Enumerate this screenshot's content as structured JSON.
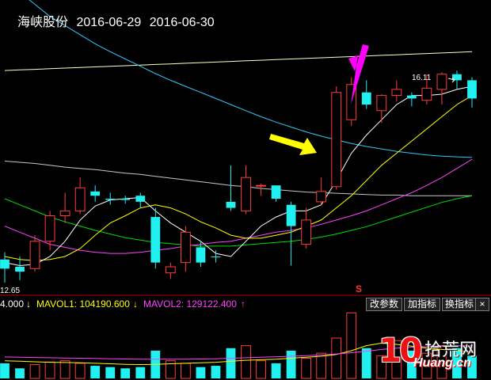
{
  "header": {
    "stock_name": "海峡股份",
    "date1": "2016-06-29",
    "date2": "2016-06-30"
  },
  "labels": {
    "high": "16.11",
    "low": "12.65",
    "signal": "S"
  },
  "volume_bar": {
    "vol_prefix": "4.000",
    "vol_arrow": "↓",
    "mavol1": "MAVOL1: 104190.600",
    "mavol1_arrow": "↓",
    "mavol2": "MAVOL2: 129122.400",
    "mavol2_arrow": "↑",
    "buttons": [
      "改参数",
      "加指标",
      "换指标"
    ],
    "close_label": "×"
  },
  "watermark": {
    "num": "10",
    "cn": "拾荒网",
    "en": "Huang.cn"
  },
  "colors": {
    "up": "#ff3c3c",
    "down": "#20f0f0",
    "ma5": "#ffffff",
    "ma10": "#ffff00",
    "ma20": "#ff40ff",
    "ma30": "#00e000",
    "ma60": "#c8c8c8",
    "ma120": "#30c8ff",
    "ma250": "#ffffc0",
    "arrow_magenta": "#ff00ff",
    "arrow_yellow": "#ffff00"
  },
  "chart_data": {
    "type": "candlestick",
    "price_range": [
      12.45,
      16.75
    ],
    "candles": [
      {
        "o": 13.0,
        "h": 13.12,
        "l": 12.62,
        "c": 12.85,
        "up": false
      },
      {
        "o": 12.88,
        "h": 13.05,
        "l": 12.66,
        "c": 12.8,
        "up": false
      },
      {
        "o": 12.85,
        "h": 13.4,
        "l": 12.8,
        "c": 13.3,
        "up": true
      },
      {
        "o": 13.3,
        "h": 13.8,
        "l": 13.15,
        "c": 13.72,
        "up": true
      },
      {
        "o": 13.72,
        "h": 14.1,
        "l": 13.6,
        "c": 13.8,
        "up": true
      },
      {
        "o": 13.8,
        "h": 14.35,
        "l": 13.75,
        "c": 14.18,
        "up": true
      },
      {
        "o": 14.12,
        "h": 14.22,
        "l": 13.95,
        "c": 14.05,
        "up": false
      },
      {
        "o": 14.0,
        "h": 14.1,
        "l": 13.9,
        "c": 13.98,
        "up": false
      },
      {
        "o": 14.0,
        "h": 14.05,
        "l": 13.92,
        "c": 13.98,
        "up": false
      },
      {
        "o": 14.05,
        "h": 14.1,
        "l": 13.85,
        "c": 13.95,
        "up": false
      },
      {
        "o": 13.7,
        "h": 13.85,
        "l": 12.85,
        "c": 12.95,
        "up": false
      },
      {
        "o": 12.78,
        "h": 12.95,
        "l": 12.68,
        "c": 12.88,
        "up": true
      },
      {
        "o": 12.95,
        "h": 13.55,
        "l": 12.8,
        "c": 13.45,
        "up": true
      },
      {
        "o": 13.2,
        "h": 13.3,
        "l": 12.88,
        "c": 12.95,
        "up": false
      },
      {
        "o": 13.05,
        "h": 13.15,
        "l": 12.95,
        "c": 13.05,
        "up": false
      },
      {
        "o": 13.85,
        "h": 14.55,
        "l": 13.8,
        "c": 13.95,
        "up": false
      },
      {
        "o": 13.8,
        "h": 14.55,
        "l": 13.75,
        "c": 14.35,
        "up": true
      },
      {
        "o": 14.22,
        "h": 14.25,
        "l": 14.05,
        "c": 14.22,
        "up": true
      },
      {
        "o": 14.22,
        "h": 14.22,
        "l": 13.95,
        "c": 14.0,
        "up": false
      },
      {
        "o": 13.9,
        "h": 13.95,
        "l": 12.9,
        "c": 13.55,
        "up": false
      },
      {
        "o": 13.25,
        "h": 13.85,
        "l": 13.18,
        "c": 13.65,
        "up": true
      },
      {
        "o": 13.95,
        "h": 14.35,
        "l": 13.9,
        "c": 14.12,
        "up": true
      },
      {
        "o": 14.2,
        "h": 15.85,
        "l": 14.15,
        "c": 15.75,
        "up": true
      },
      {
        "o": 15.3,
        "h": 16.0,
        "l": 15.2,
        "c": 15.88,
        "up": true
      },
      {
        "o": 15.75,
        "h": 15.95,
        "l": 15.48,
        "c": 15.55,
        "up": false
      },
      {
        "o": 15.45,
        "h": 15.72,
        "l": 15.25,
        "c": 15.7,
        "up": true
      },
      {
        "o": 15.7,
        "h": 15.95,
        "l": 15.6,
        "c": 15.8,
        "up": true
      },
      {
        "o": 15.7,
        "h": 15.75,
        "l": 15.52,
        "c": 15.65,
        "up": false
      },
      {
        "o": 15.62,
        "h": 16.05,
        "l": 15.55,
        "c": 15.82,
        "up": true
      },
      {
        "o": 15.8,
        "h": 16.08,
        "l": 15.55,
        "c": 16.05,
        "up": true
      },
      {
        "o": 16.05,
        "h": 16.11,
        "l": 15.8,
        "c": 15.95,
        "up": false
      },
      {
        "o": 15.95,
        "h": 16.0,
        "l": 15.5,
        "c": 15.65,
        "up": false
      }
    ],
    "ma5": [
      12.95,
      12.9,
      12.92,
      13.05,
      13.3,
      13.65,
      13.88,
      13.98,
      14.0,
      14.02,
      13.8,
      13.6,
      13.45,
      13.3,
      13.1,
      13.05,
      13.3,
      13.55,
      13.7,
      13.8,
      13.8,
      13.9,
      14.3,
      14.75,
      15.05,
      15.3,
      15.55,
      15.7,
      15.7,
      15.72,
      15.8,
      15.85
    ],
    "ma10": [
      13.05,
      13.0,
      12.98,
      13.0,
      13.05,
      13.18,
      13.4,
      13.6,
      13.72,
      13.85,
      13.9,
      13.85,
      13.75,
      13.62,
      13.52,
      13.4,
      13.35,
      13.35,
      13.4,
      13.45,
      13.55,
      13.65,
      13.85,
      14.05,
      14.3,
      14.55,
      14.75,
      14.95,
      15.15,
      15.35,
      15.55,
      15.7
    ],
    "ma20": [
      13.55,
      13.45,
      13.35,
      13.25,
      13.2,
      13.15,
      13.12,
      13.1,
      13.1,
      13.12,
      13.15,
      13.18,
      13.22,
      13.25,
      13.28,
      13.3,
      13.35,
      13.4,
      13.45,
      13.48,
      13.52,
      13.58,
      13.65,
      13.72,
      13.8,
      13.9,
      14.0,
      14.1,
      14.22,
      14.35,
      14.5,
      14.65
    ],
    "ma30": [
      14.0,
      13.9,
      13.8,
      13.7,
      13.62,
      13.55,
      13.48,
      13.42,
      13.36,
      13.32,
      13.28,
      13.26,
      13.24,
      13.22,
      13.22,
      13.22,
      13.24,
      13.26,
      13.28,
      13.3,
      13.33,
      13.37,
      13.42,
      13.48,
      13.54,
      13.62,
      13.7,
      13.78,
      13.86,
      13.94,
      14.0,
      14.05
    ],
    "ma60": [
      14.62,
      14.6,
      14.58,
      14.55,
      14.52,
      14.5,
      14.48,
      14.45,
      14.42,
      14.4,
      14.37,
      14.34,
      14.31,
      14.28,
      14.25,
      14.22,
      14.2,
      14.17,
      14.15,
      14.13,
      14.11,
      14.1,
      14.09,
      14.08,
      14.07,
      14.06,
      14.06,
      14.05,
      14.05,
      14.05,
      14.05,
      14.05
    ],
    "ma120": [
      17.6,
      17.4,
      17.2,
      17.0,
      16.85,
      16.7,
      16.55,
      16.42,
      16.3,
      16.18,
      16.06,
      15.95,
      15.85,
      15.75,
      15.65,
      15.55,
      15.45,
      15.35,
      15.26,
      15.18,
      15.1,
      15.03,
      14.97,
      14.91,
      14.86,
      14.82,
      14.78,
      14.75,
      14.72,
      14.7,
      14.69,
      14.68
    ],
    "ma250": [
      16.11,
      16.12,
      16.13,
      16.14,
      16.15,
      16.16,
      16.17,
      16.18,
      16.19,
      16.2,
      16.21,
      16.22,
      16.23,
      16.24,
      16.25,
      16.26,
      16.27,
      16.28,
      16.29,
      16.3,
      16.31,
      16.32,
      16.33,
      16.34,
      16.35,
      16.36,
      16.37,
      16.38,
      16.39,
      16.4,
      16.41,
      16.42
    ],
    "volume_range": [
      0,
      270000
    ],
    "volumes": [
      60000,
      40000,
      55000,
      65000,
      70000,
      60000,
      50000,
      45000,
      40000,
      45000,
      110000,
      70000,
      60000,
      45000,
      50000,
      120000,
      130000,
      70000,
      60000,
      110000,
      80000,
      100000,
      160000,
      260000,
      120000,
      90000,
      150000,
      110000,
      100000,
      130000,
      120000,
      90000
    ],
    "mavol1": [
      70000,
      68000,
      66000,
      64000,
      63000,
      62000,
      60000,
      58000,
      56000,
      55000,
      56000,
      58000,
      60000,
      62000,
      64000,
      68000,
      72000,
      74000,
      76000,
      80000,
      84000,
      88000,
      95000,
      110000,
      130000,
      140000,
      135000,
      128000,
      120000,
      115000,
      110000,
      104190
    ],
    "mavol2": [
      85000,
      84000,
      83000,
      82000,
      81000,
      80000,
      79000,
      78000,
      77000,
      76000,
      76000,
      76000,
      76000,
      77000,
      78000,
      80000,
      82000,
      84000,
      86000,
      88000,
      90000,
      93000,
      97000,
      102000,
      108000,
      115000,
      120000,
      124000,
      126000,
      128000,
      129000,
      129122
    ]
  }
}
